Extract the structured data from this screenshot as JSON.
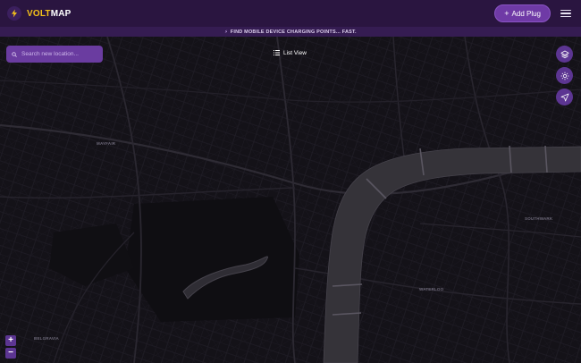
{
  "header": {
    "brand_part1": "VOLT",
    "brand_part2": "MAP",
    "add_plug_label": "Add Plug",
    "add_plug_icon": "plus-icon",
    "menu_icon": "hamburger-menu-icon",
    "logo_icon": "lightning-bolt-icon"
  },
  "banner": {
    "text": "FIND MOBILE DEVICE CHARGING POINTS... FAST.",
    "icon": "bolt-small-icon"
  },
  "search": {
    "placeholder": "Search new location..."
  },
  "list_view": {
    "label": "List View",
    "icon": "list-icon"
  },
  "map_controls": {
    "layers_icon": "layers-icon",
    "theme_icon": "sun-icon",
    "locate_icon": "navigation-arrow-icon",
    "zoom_in": "+",
    "zoom_out": "−"
  },
  "map_labels": [
    "MAYFAIR",
    "WATERLOO",
    "SOUTHWARK",
    "BELGRAVIA"
  ],
  "colors": {
    "header_bg": "#2a1540",
    "banner_bg": "#351c52",
    "accent": "#6f3aa6",
    "brand_yellow": "#f4c21a",
    "map_bg": "#121016",
    "river": "#353339"
  }
}
